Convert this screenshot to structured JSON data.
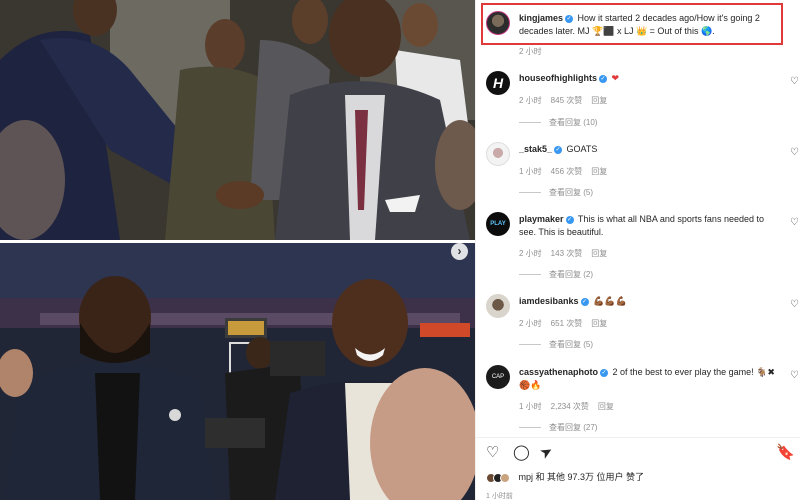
{
  "post": {
    "author": "kingjames",
    "caption": "How it started 2 decades ago/How it's going 2 decades later. MJ 🏆⬛ x LJ 👑 = Out of this 🌎.",
    "caption_time": "2 小时"
  },
  "comments": [
    {
      "user": "houseofhighlights",
      "text": "❤",
      "time": "2 小时",
      "likes": "845 次赞",
      "reply": "回复",
      "view_replies": "查看回复 (10)"
    },
    {
      "user": "_stak5_",
      "text": "GOATS",
      "time": "1 小时",
      "likes": "456 次赞",
      "reply": "回复",
      "view_replies": "查看回复 (5)"
    },
    {
      "user": "playmaker",
      "text": "This is what all NBA and sports fans needed to see. This is beautiful.",
      "time": "2 小时",
      "likes": "143 次赞",
      "reply": "回复",
      "view_replies": "查看回复 (2)"
    },
    {
      "user": "iamdesibanks",
      "text": "💪🏾💪🏾💪🏾",
      "time": "2 小时",
      "likes": "651 次赞",
      "reply": "回复",
      "view_replies": "查看回复 (5)"
    },
    {
      "user": "cassyathenaphoto",
      "text": "2 of the best to ever play the game! 🐐✖🏀🔥",
      "time": "1 小时",
      "likes": "2,234 次赞",
      "reply": "回复",
      "view_replies": "查看回复 (27)"
    }
  ],
  "actions": {
    "like_icon": "♡",
    "comment_icon": "◯",
    "share_icon": "➤",
    "save_icon": "🔖"
  },
  "likes_summary": "mpj 和 其他 97.3万 位用户 赞了",
  "posted_ago": "1 小时前",
  "carousel": {
    "next_icon": "›"
  },
  "colors": {
    "highlight_border": "#e0393c",
    "verified": "#3897f0",
    "secondary_text": "#8e8e8e"
  }
}
